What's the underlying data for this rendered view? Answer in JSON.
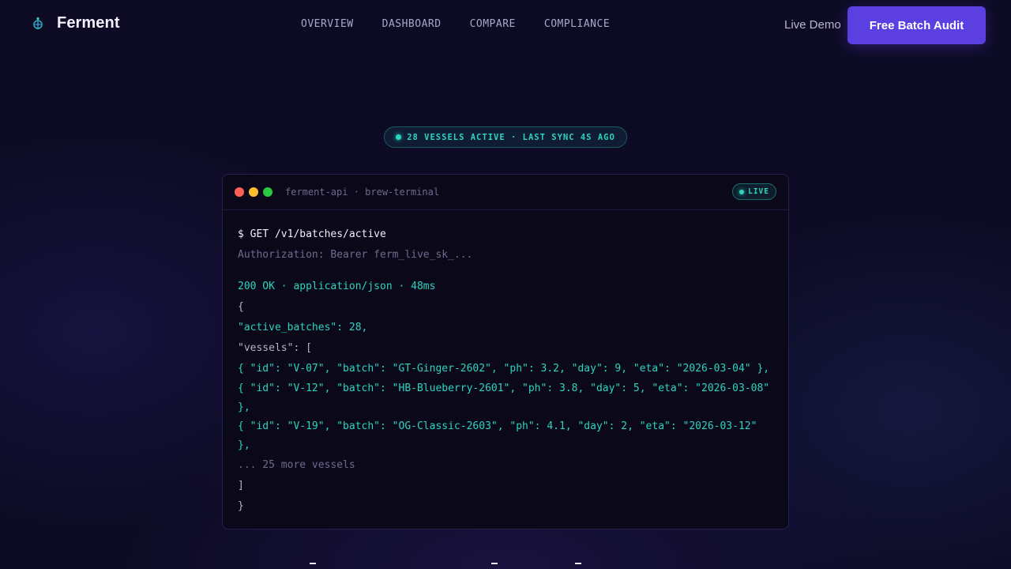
{
  "nav": {
    "brand": "Ferment",
    "links": [
      "OVERVIEW",
      "DASHBOARD",
      "COMPARE",
      "COMPLIANCE"
    ],
    "live_demo": "Live Demo",
    "cta": "Free Batch Audit"
  },
  "status": {
    "text": "28 VESSELS ACTIVE · LAST SYNC 4S AGO"
  },
  "terminal": {
    "title": "ferment-api · brew-terminal",
    "badge": "LIVE",
    "request": "$ GET /v1/batches/active",
    "auth": "Authorization: Bearer ferm_live_sk_...",
    "response_status": "200 OK · application/json · 48ms",
    "open_brace": "{",
    "active_batches": "\"active_batches\": 28,",
    "vessels_open": "\"vessels\": [",
    "vessel_1": "{ \"id\": \"V-07\", \"batch\": \"GT-Ginger-2602\", \"ph\": 3.2, \"day\": 9, \"eta\": \"2026-03-04\" },",
    "vessel_2": "{ \"id\": \"V-12\", \"batch\": \"HB-Blueberry-2601\", \"ph\": 3.8, \"day\": 5, \"eta\": \"2026-03-08\" },",
    "vessel_3": "{ \"id\": \"V-19\", \"batch\": \"OG-Classic-2603\", \"ph\": 4.1, \"day\": 2, \"eta\": \"2026-03-12\" },",
    "more": "... 25 more vessels",
    "close_bracket": "]",
    "close_brace": "}"
  },
  "colors": {
    "accent": "#5b3fe0",
    "teal": "#2dd4bf",
    "background": "#0d0b24"
  }
}
